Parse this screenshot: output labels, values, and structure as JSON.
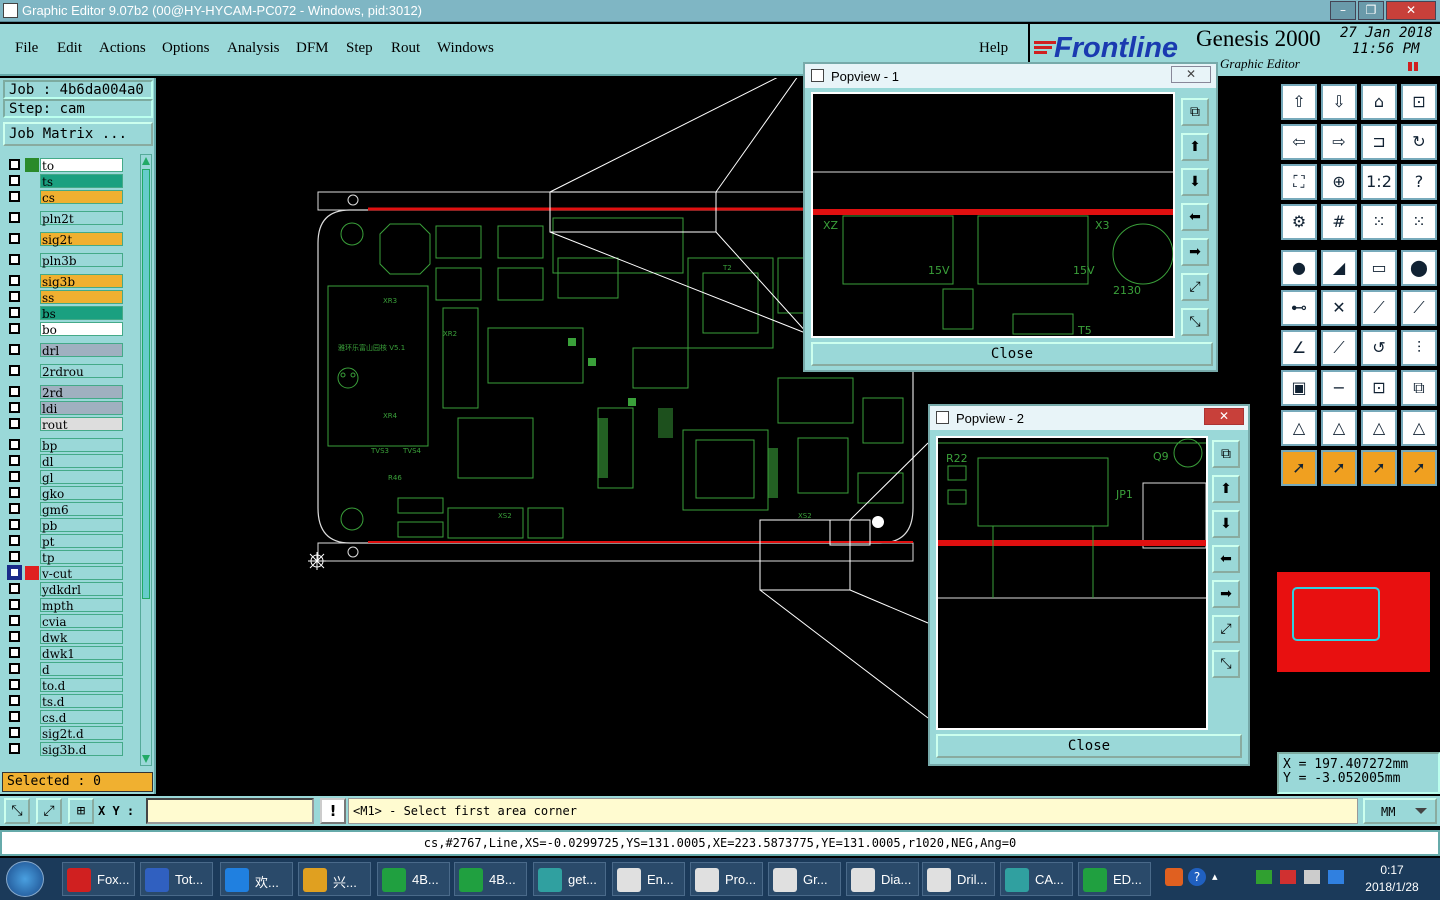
{
  "window": {
    "title": "Graphic Editor 9.07b2 (00@HY-HYCAM-PC072 - Windows, pid:3012)",
    "min": "–",
    "max": "❐",
    "close": "✕"
  },
  "menu": [
    "File",
    "Edit",
    "Actions",
    "Options",
    "Analysis",
    "DFM",
    "Step",
    "Rout",
    "Windows"
  ],
  "help": "Help",
  "brand": {
    "logo": "Frontline",
    "product": "Genesis 2000",
    "subtitle": "Graphic Editor",
    "date": "27 Jan 2018",
    "time": "11:56 PM"
  },
  "job": {
    "job": "Job : 4b6da004a0",
    "step": "Step: cam",
    "matrix": "Job Matrix ..."
  },
  "layers": [
    {
      "name": "to",
      "color": "#ffffff",
      "mark": "#2a8a2a"
    },
    {
      "name": "ts",
      "color": "#1aa080"
    },
    {
      "name": "cs",
      "color": "#f0b030"
    },
    {
      "name": "pln2t",
      "color": "#9ad8d8"
    },
    {
      "name": "sig2t",
      "color": "#f0b030"
    },
    {
      "name": "pln3b",
      "color": "#9ad8d8"
    },
    {
      "name": "sig3b",
      "color": "#f0b030"
    },
    {
      "name": "ss",
      "color": "#f0b030"
    },
    {
      "name": "bs",
      "color": "#1aa080"
    },
    {
      "name": "bo",
      "color": "#ffffff"
    },
    {
      "name": "drl",
      "color": "#a0b0c0"
    },
    {
      "name": "2rdrou",
      "color": "#9ad8d8"
    },
    {
      "name": "2rd",
      "color": "#a0b0c0"
    },
    {
      "name": "ldi",
      "color": "#a0b0c0"
    },
    {
      "name": "rout",
      "color": "#dddddd"
    },
    {
      "name": "bp",
      "color": "#9ad8d8"
    },
    {
      "name": "dl",
      "color": "#9ad8d8"
    },
    {
      "name": "gl",
      "color": "#9ad8d8"
    },
    {
      "name": "gko",
      "color": "#9ad8d8"
    },
    {
      "name": "gm6",
      "color": "#9ad8d8"
    },
    {
      "name": "pb",
      "color": "#9ad8d8"
    },
    {
      "name": "pt",
      "color": "#9ad8d8"
    },
    {
      "name": "tp",
      "color": "#9ad8d8"
    },
    {
      "name": "v-cut",
      "color": "#9ad8d8",
      "mark": "#e02020"
    },
    {
      "name": "ydkdrl",
      "color": "#9ad8d8"
    },
    {
      "name": "mpth",
      "color": "#9ad8d8"
    },
    {
      "name": "cvia",
      "color": "#9ad8d8"
    },
    {
      "name": "dwk",
      "color": "#9ad8d8"
    },
    {
      "name": "dwk1",
      "color": "#9ad8d8"
    },
    {
      "name": "d",
      "color": "#9ad8d8"
    },
    {
      "name": "to.d",
      "color": "#9ad8d8"
    },
    {
      "name": "ts.d",
      "color": "#9ad8d8"
    },
    {
      "name": "cs.d",
      "color": "#9ad8d8"
    },
    {
      "name": "sig2t.d",
      "color": "#9ad8d8"
    },
    {
      "name": "sig3b.d",
      "color": "#9ad8d8"
    }
  ],
  "selected": "Selected : 0",
  "popview1": {
    "title": "Popview - 1",
    "close": "Close"
  },
  "popview2": {
    "title": "Popview - 2",
    "close": "Close"
  },
  "coords": {
    "x": "X  = 197.407272mm",
    "y": "Y  = -3.052005mm"
  },
  "cmd": {
    "xy_label": "X Y :",
    "xy_value": "",
    "prompt": "<M1> - Select first area corner",
    "units": "MM"
  },
  "status": "cs,#2767,Line,XS=-0.0299725,YS=131.0005,XE=223.5873775,YE=131.0005,r1020,NEG,Ang=0",
  "taskbar": {
    "items": [
      {
        "label": "Fox...",
        "color": "#d02020"
      },
      {
        "label": "Tot...",
        "color": "#3060c0"
      },
      {
        "label": "欢...",
        "color": "#2080e0"
      },
      {
        "label": "兴...",
        "color": "#e0a020"
      },
      {
        "label": "4B...",
        "color": "#20a040"
      },
      {
        "label": "4B...",
        "color": "#20a040"
      },
      {
        "label": "get...",
        "color": "#30a0a0"
      },
      {
        "label": "En...",
        "color": "#e0e0e0"
      },
      {
        "label": "Pro...",
        "color": "#e0e0e0"
      },
      {
        "label": "Gr...",
        "color": "#e0e0e0"
      },
      {
        "label": "Dia...",
        "color": "#e0e0e0"
      },
      {
        "label": "Dril...",
        "color": "#e0e0e0"
      },
      {
        "label": "CA...",
        "color": "#30a0a0"
      },
      {
        "label": "ED...",
        "color": "#20a040"
      }
    ],
    "time": "0:17",
    "date": "2018/1/28"
  }
}
